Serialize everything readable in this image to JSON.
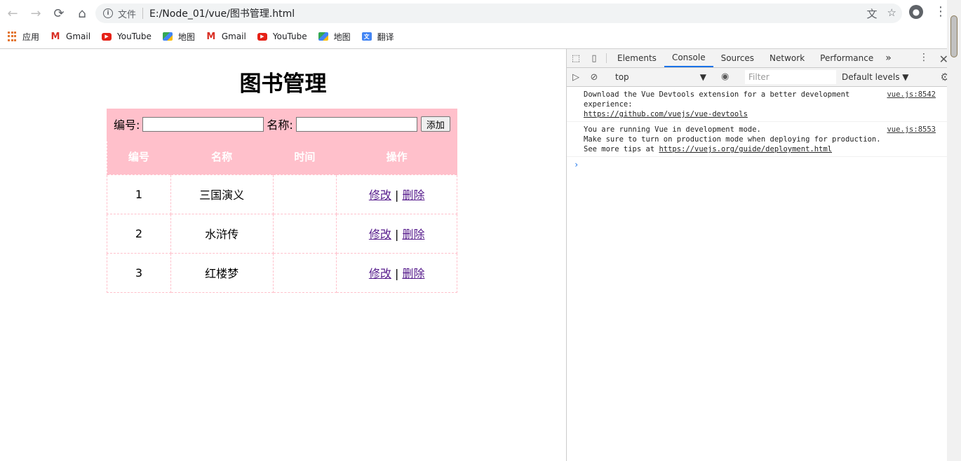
{
  "browser": {
    "url_prefix": "文件",
    "url": "E:/Node_01/vue/图书管理.html",
    "icons": {
      "back": "←",
      "forward": "→",
      "reload": "⟳",
      "home": "⌂",
      "translate": "文",
      "star": "☆",
      "account": "●",
      "menu": "⋮"
    }
  },
  "bookmarks": [
    {
      "label": "应用",
      "icon": "apps-icon"
    },
    {
      "label": "Gmail",
      "icon": "gmail-icon"
    },
    {
      "label": "YouTube",
      "icon": "youtube-icon"
    },
    {
      "label": "地图",
      "icon": "maps-icon"
    },
    {
      "label": "Gmail",
      "icon": "gmail-icon"
    },
    {
      "label": "YouTube",
      "icon": "youtube-icon"
    },
    {
      "label": "地图",
      "icon": "maps-icon"
    },
    {
      "label": "翻译",
      "icon": "translate-icon"
    }
  ],
  "page": {
    "title": "图书管理",
    "form": {
      "id_label": "编号:",
      "name_label": "名称:",
      "add_button": "添加"
    },
    "columns": [
      "编号",
      "名称",
      "时间",
      "操作"
    ],
    "rows": [
      {
        "id": "1",
        "name": "三国演义",
        "time": "",
        "edit": "修改",
        "sep": "|",
        "delete": "删除"
      },
      {
        "id": "2",
        "name": "水浒传",
        "time": "",
        "edit": "修改",
        "sep": "|",
        "delete": "删除"
      },
      {
        "id": "3",
        "name": "红楼梦",
        "time": "",
        "edit": "修改",
        "sep": "|",
        "delete": "删除"
      }
    ]
  },
  "devtools": {
    "tabs": [
      "Elements",
      "Console",
      "Sources",
      "Network",
      "Performance"
    ],
    "active_tab": "Console",
    "more": "»",
    "context": "top",
    "context_arrow": "▼",
    "filter_placeholder": "Filter",
    "levels": "Default levels ▼",
    "messages": [
      {
        "lines": [
          "Download the Vue Devtools extension for a better development",
          "experience:"
        ],
        "link": "https://github.com/vuejs/vue-devtools",
        "link_prefix": "",
        "source": "vue.js:8542"
      },
      {
        "lines": [
          "You are running Vue in development mode.",
          "Make sure to turn on production mode when deploying for production."
        ],
        "link": "https://vuejs.org/guide/deployment.html",
        "link_prefix": "See more tips at ",
        "source": "vue.js:8553"
      }
    ],
    "prompt": "›"
  }
}
